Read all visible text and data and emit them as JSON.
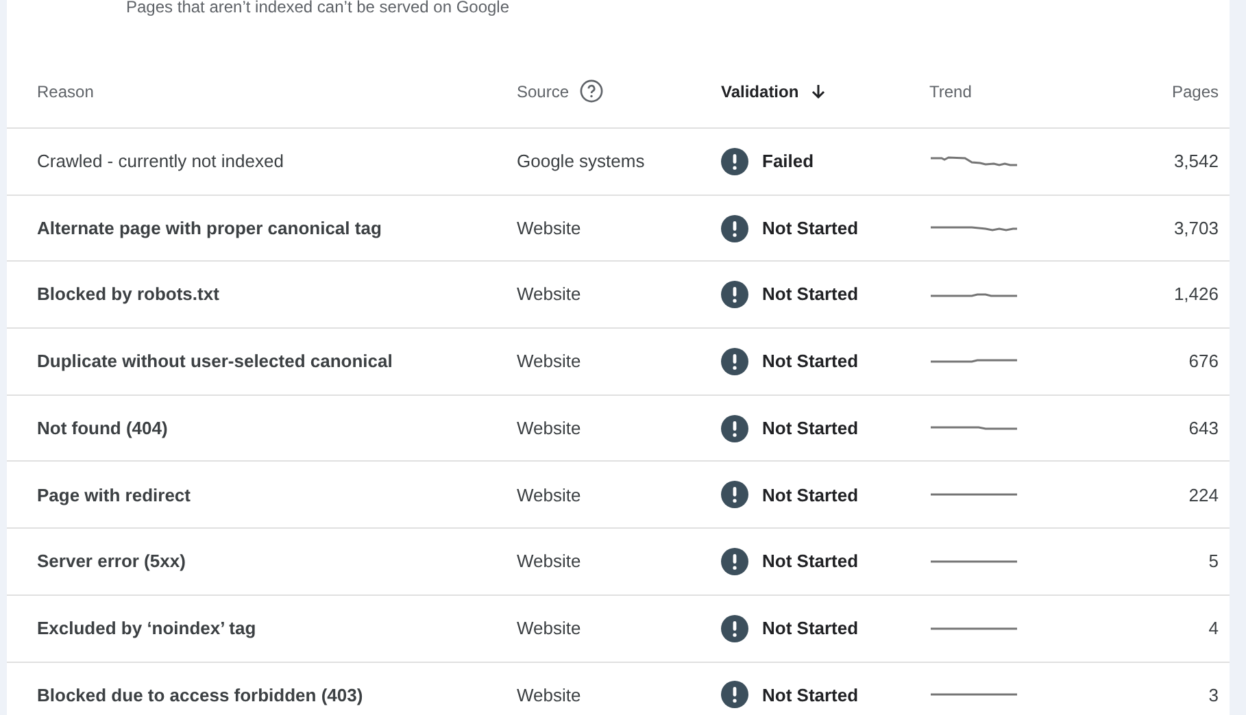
{
  "subtitle": "Pages that aren’t indexed can’t be served on Google",
  "table": {
    "columns": [
      {
        "label": "Reason",
        "sorted": false,
        "help": false
      },
      {
        "label": "Source",
        "sorted": false,
        "help": true
      },
      {
        "label": "Validation",
        "sorted": true,
        "help": false
      },
      {
        "label": "Trend",
        "sorted": false,
        "help": false
      },
      {
        "label": "Pages",
        "sorted": false,
        "help": false
      }
    ],
    "rows": [
      {
        "reason": "Crawled - currently not indexed",
        "emphasized": false,
        "source": "Google systems",
        "validation": "Failed",
        "pages": "3,542"
      },
      {
        "reason": "Alternate page with proper canonical tag",
        "emphasized": true,
        "source": "Website",
        "validation": "Not Started",
        "pages": "3,703"
      },
      {
        "reason": "Blocked by robots.txt",
        "emphasized": true,
        "source": "Website",
        "validation": "Not Started",
        "pages": "1,426"
      },
      {
        "reason": "Duplicate without user-selected canonical",
        "emphasized": true,
        "source": "Website",
        "validation": "Not Started",
        "pages": "676"
      },
      {
        "reason": "Not found (404)",
        "emphasized": true,
        "source": "Website",
        "validation": "Not Started",
        "pages": "643"
      },
      {
        "reason": "Page with redirect",
        "emphasized": true,
        "source": "Website",
        "validation": "Not Started",
        "pages": "224"
      },
      {
        "reason": "Server error (5xx)",
        "emphasized": true,
        "source": "Website",
        "validation": "Not Started",
        "pages": "5"
      },
      {
        "reason": "Excluded by ‘noindex’ tag",
        "emphasized": true,
        "source": "Website",
        "validation": "Not Started",
        "pages": "4"
      },
      {
        "reason": "Blocked due to access forbidden (403)",
        "emphasized": true,
        "source": "Website",
        "validation": "Not Started",
        "pages": "3"
      }
    ]
  }
}
